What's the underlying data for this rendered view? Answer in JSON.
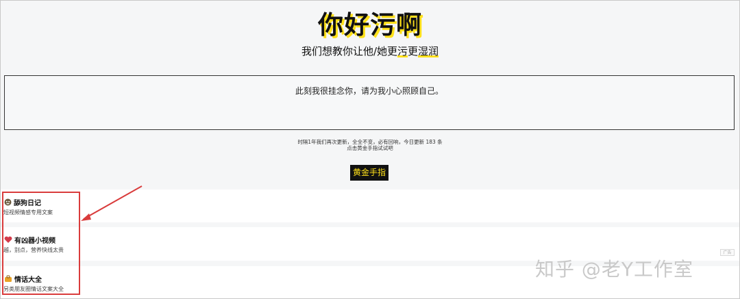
{
  "header": {
    "site_title": "你好污啊",
    "tagline_a": "我们想教你让他/她更",
    "tagline_b": "污",
    "tagline_c": "更",
    "tagline_d": "湿润"
  },
  "quote": {
    "text": "此刻我很挂念你，请为我小心照顾自己。"
  },
  "notice": {
    "line1": "时隔1年我们再次更新，全全不变，必有回响，今日更新 183 条",
    "line2": "点击黄金手指试试吧"
  },
  "gold_button": {
    "label": "黄金手指"
  },
  "cards": [
    {
      "title": "舔狗日记",
      "desc": "短视频情感专用文案",
      "icon": "dog-icon"
    },
    {
      "title": "有凶器小视频",
      "desc": "越，别点，营养快线太贵",
      "icon": "heart-icon"
    },
    {
      "title": "情话大全",
      "desc": "另类朋友圈情话文案大全",
      "icon": "bag-icon"
    }
  ],
  "ad_badge": "广告",
  "watermark": "知乎 @老Y工作室",
  "colors": {
    "accent": "#ffe11a",
    "annotation": "#d93b3b",
    "button_bg": "#111111"
  }
}
